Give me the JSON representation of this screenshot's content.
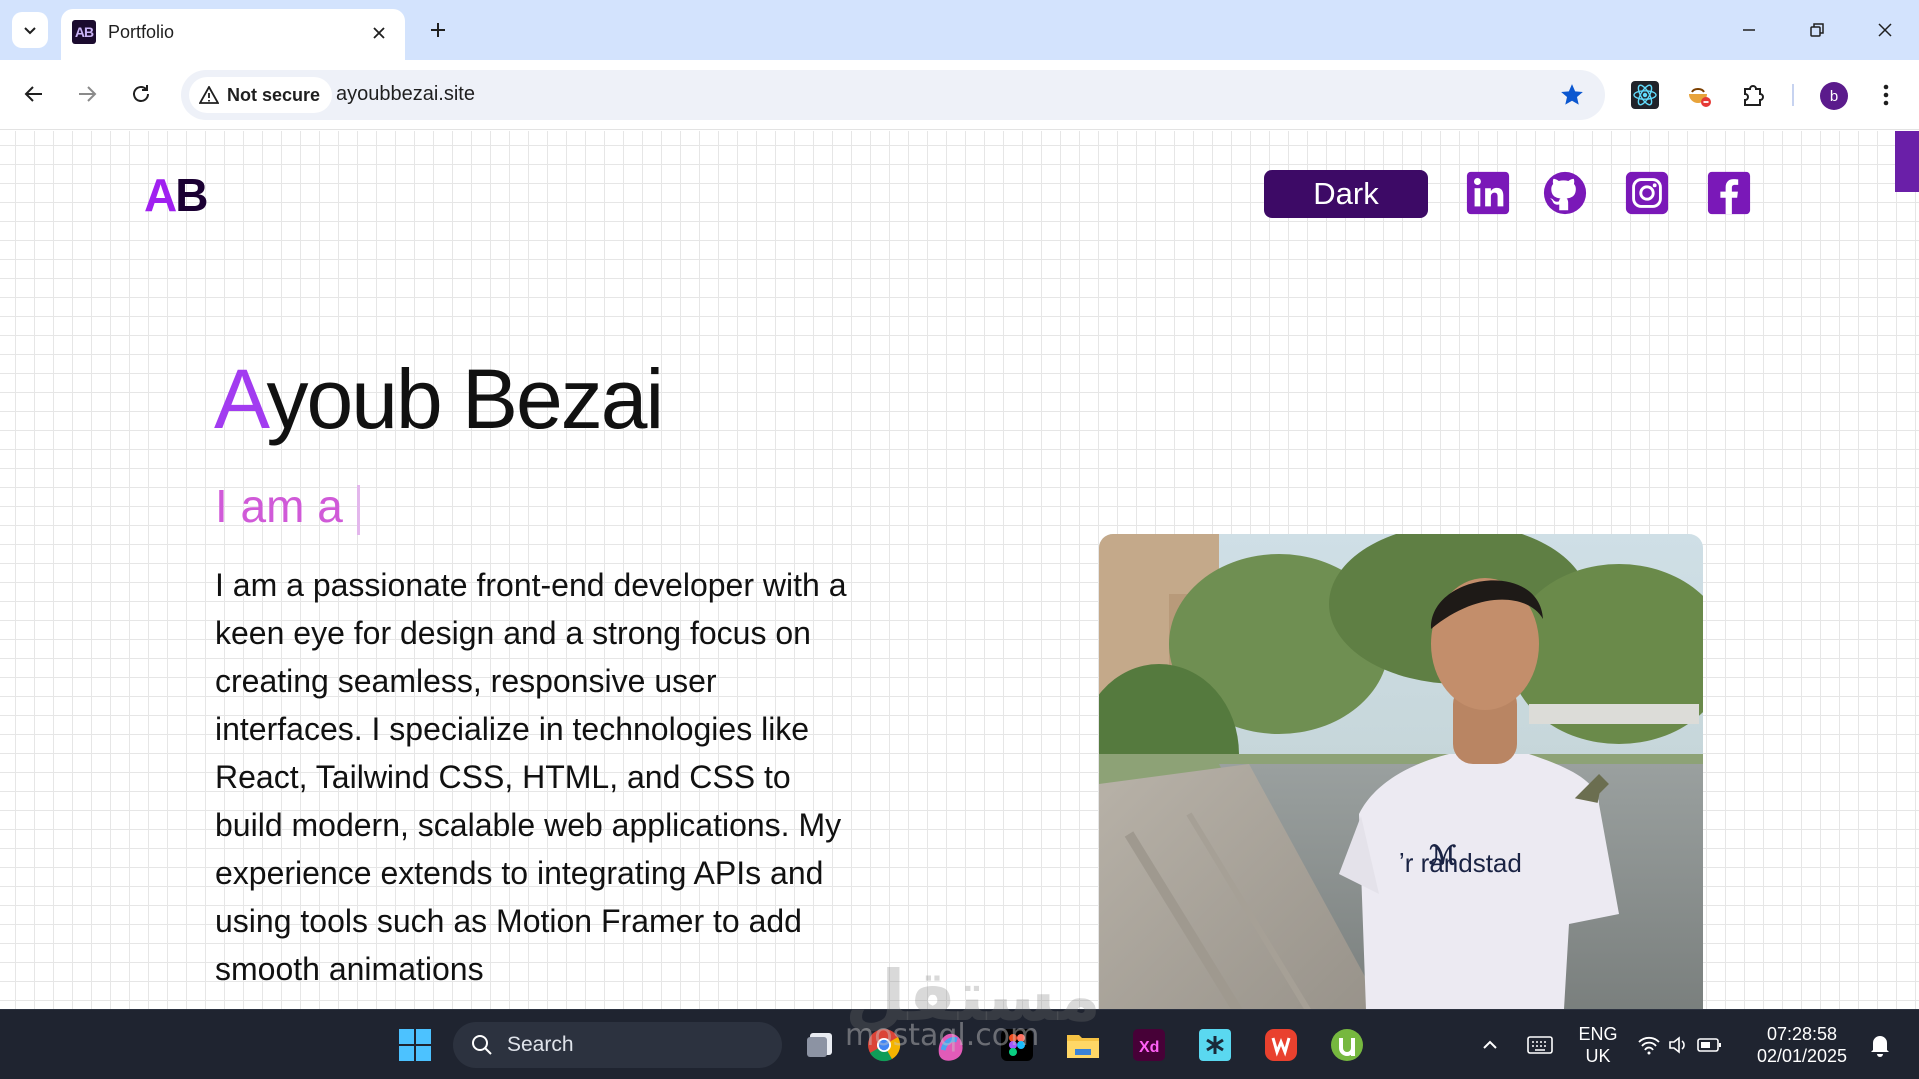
{
  "browser": {
    "tab": {
      "favicon_text": "AB",
      "title": "Portfolio"
    },
    "omnibox": {
      "security_label": "Not secure",
      "url": "ayoubbezai.site"
    },
    "profile_initial": "b"
  },
  "page": {
    "logo": {
      "first": "A",
      "rest": "B"
    },
    "theme_button_label": "Dark",
    "social_links": [
      "linkedin-icon",
      "github-icon",
      "instagram-icon",
      "facebook-icon"
    ],
    "name": {
      "first_letter": "A",
      "rest": "youb Bezai"
    },
    "typing_prefix": "I am a",
    "bio": "I am a passionate front-end developer with a keen eye for design and a strong focus on creating seamless, responsive user interfaces. I specialize in technologies like React, Tailwind CSS, HTML, and CSS to build modern, scalable web applications. My experience extends to integrating APIs and using tools such as Motion Framer to add smooth animations"
  },
  "taskbar": {
    "search_placeholder": "Search",
    "language_line1": "ENG",
    "language_line2": "UK",
    "time": "07:28:58",
    "date": "02/01/2025"
  },
  "watermark": {
    "arabic": "مستقل",
    "latin": "mostaql.com"
  },
  "colors": {
    "accent": "#3d0a66",
    "brand_purple": "#a020f0",
    "tabstrip": "#d3e3fd",
    "taskbar": "#1f2430"
  }
}
